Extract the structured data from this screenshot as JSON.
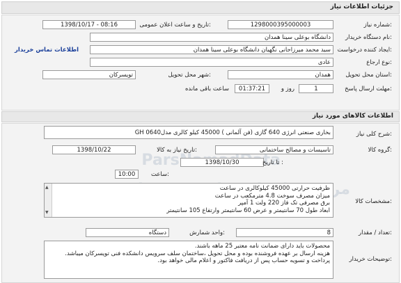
{
  "header": {
    "title": "جزئیات اطلاعات نیاز"
  },
  "need": {
    "number_label": "شماره نیاز:",
    "number_value": "1298000395000003",
    "announce_label": "تاریخ و ساعت اعلان عمومی:",
    "announce_value": "1398/10/17 - 08:16",
    "buyer_label": "نام دستگاه خریدار:",
    "buyer_value": "دانشگاه بوعلی سینا همدان",
    "creator_label": "ایجاد کننده درخواست:",
    "creator_value": "سید محمد  میرزاجانی نگهبان دانشگاه بوعلی سینا همدان",
    "contact_link": "اطلاعات تماس خریدار",
    "priority_label": "نوع ارجاع:",
    "priority_value": "عادی",
    "province_label": "استان محل تحویل:",
    "province_value": "همدان",
    "city_label": "شهر محل تحویل:",
    "city_value": "تویسرکان",
    "deadline_label": "مهلت ارسال پاسخ:",
    "days_value": "1",
    "days_unit": "روز و",
    "time_value": "01:37:21",
    "time_suffix": "ساعت باقی مانده"
  },
  "goods_section": {
    "title": "اطلاعات کالاهای مورد نیاز"
  },
  "goods": {
    "summary_label": "شرح کلی نیاز:",
    "summary_value": "بخاری صنعتی انرژی 640 گازی (فن آلمانی ) 45000 کیلو کالری مدل0640 GH",
    "group_label": "گروه کالا:",
    "group_value": "تاسیسات و مصالح ساختمانی",
    "need_date_label": "تاریخ نیاز به کالا:",
    "need_date_value": "1398/10/22",
    "validity_label": "تا تاریخ :",
    "validity_value": "1398/10/30",
    "time_label": "ساعت:",
    "time_value": "10:00",
    "spec_label": "مشخصات کالا:",
    "spec_lines": [
      "ظرفیت حرارتی 45000 کیلوکالری در ساعت",
      "میزان مصرف سوخت 4.8 مترمکعب در ساعت",
      "برق مصرفی تک فاز 220 ولت 1 آمپر",
      "ابعاد طول 70 سانتیمتر و عرض 60 سانتیمتر وارتفاع 105 سانتیمتر"
    ],
    "qty_label": "تعداد / مقدار:",
    "qty_value": "8",
    "unit_label": "واحد شمارش:",
    "unit_value": "دستگاه",
    "notes_label": "توضیحات خریدار:",
    "notes_lines": [
      "محصولات باید دارای ضمانت نامه معتبر 25 ماهه باشند.",
      "هزینه ارسال بر عهده فروشنده بوده و محل تحویل ،ساختمان سلف سرویس دانشکده فنی تویسرکان میباشد.",
      "پرداخت و تسویه حساب پس از دریافت فاکتور و اعلام مالی خواهد بود."
    ]
  },
  "watermark": {
    "line1": "مرکز فراخوان مناقصه و مزایده",
    "line2": "ParsNamadData"
  }
}
